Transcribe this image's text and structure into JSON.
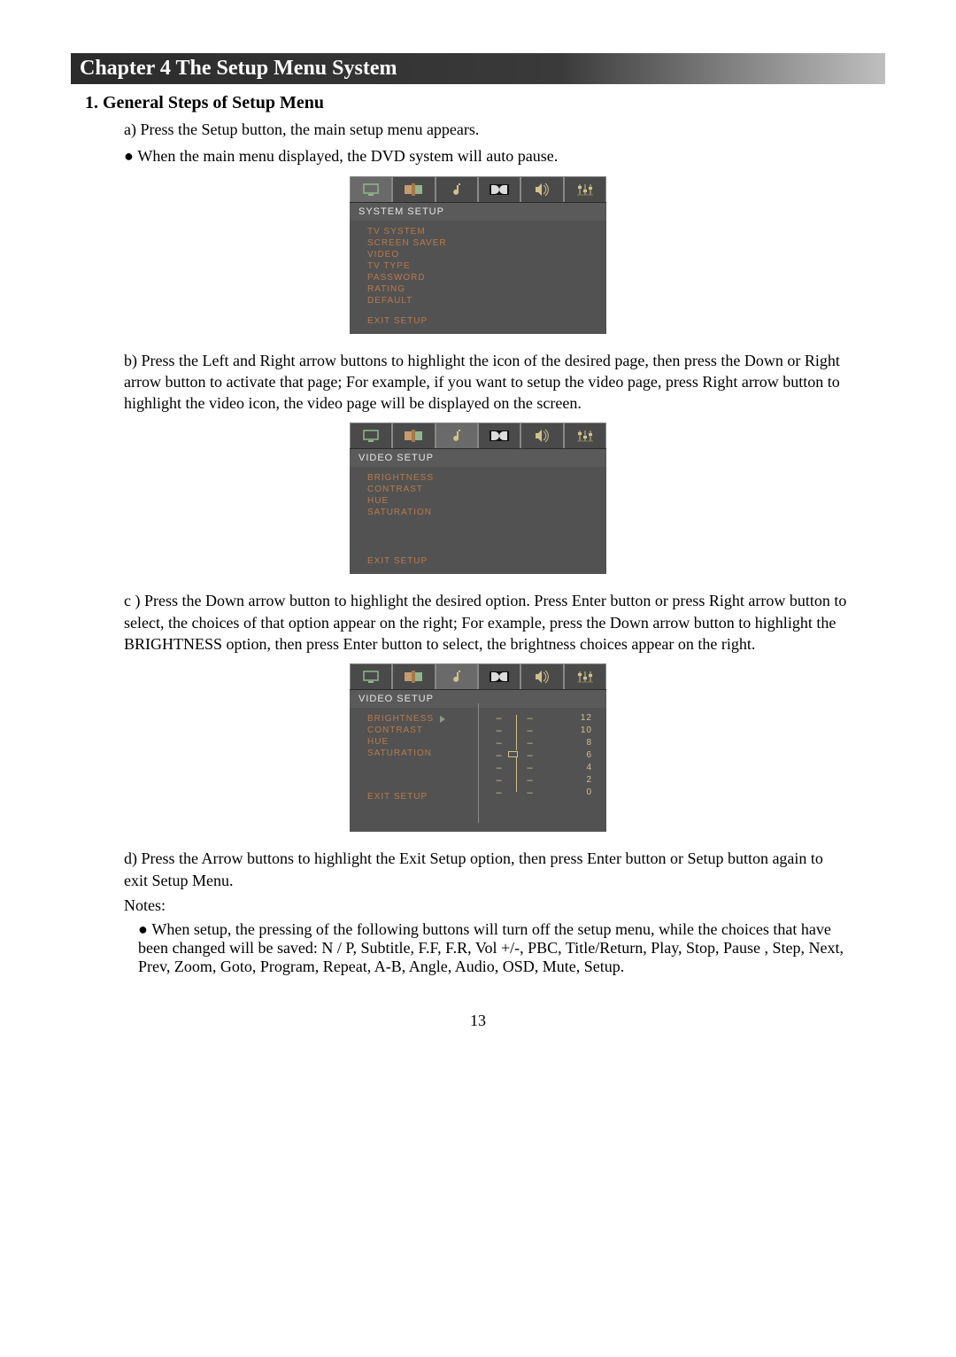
{
  "chapter_title": "Chapter 4 The Setup Menu System",
  "section_title": "1.  General Steps of Setup Menu",
  "step_a": "a)  Press the Setup button, the main setup menu appears.",
  "step_a_bullet": "When the main menu displayed, the DVD system will auto pause.",
  "step_b": "b)  Press the Left and Right arrow buttons to highlight the icon of the desired page, then press the Down or Right arrow button to activate that page; For example, if you want to setup the video page, press Right arrow button to highlight  the video icon, the video page will be displayed on the screen.",
  "step_c": "c )  Press the Down arrow button to highlight the desired option. Press Enter button or press Right arrow button to select, the choices of that option appear on the right; For example, press the Down arrow button to highlight  the BRIGHTNESS option, then press Enter button to select, the brightness choices appear on the right.",
  "step_d": "d)  Press the Arrow buttons to highlight the Exit Setup option, then press Enter button or Setup button again to exit Setup Menu.",
  "notes_label": "Notes:",
  "notes_bullet": "When setup, the pressing of the following buttons will turn off the setup menu, while the choices that have been changed will be saved: N / P, Subtitle, F.F, F.R, Vol +/-, PBC, Title/Return, Play, Stop, Pause , Step, Next, Prev, Zoom,  Goto, Program, Repeat, A-B, Angle, Audio, OSD, Mute, Setup.",
  "page_number": "13",
  "box1": {
    "header": "SYSTEM SETUP",
    "items": [
      "TV SYSTEM",
      "SCREEN SAVER",
      "VIDEO",
      "TV TYPE",
      "PASSWORD",
      "RATING",
      "DEFAULT"
    ],
    "exit": "EXIT SETUP"
  },
  "box2": {
    "header": "VIDEO   SETUP",
    "items": [
      "BRIGHTNESS",
      "CONTRAST",
      "HUE",
      "SATURATION"
    ],
    "exit": "EXIT SETUP"
  },
  "box3": {
    "header": "VIDEO   SETUP",
    "items": [
      "BRIGHTNESS",
      "CONTRAST",
      "HUE",
      "SATURATION"
    ],
    "exit": "EXIT SETUP",
    "values": [
      "12",
      "10",
      "8",
      "6",
      "4",
      "2",
      "0"
    ]
  },
  "tab_icons": [
    "monitor-icon",
    "language-icon",
    "note-icon",
    "dolby-icon",
    "speaker-icon",
    "equalizer-icon"
  ]
}
